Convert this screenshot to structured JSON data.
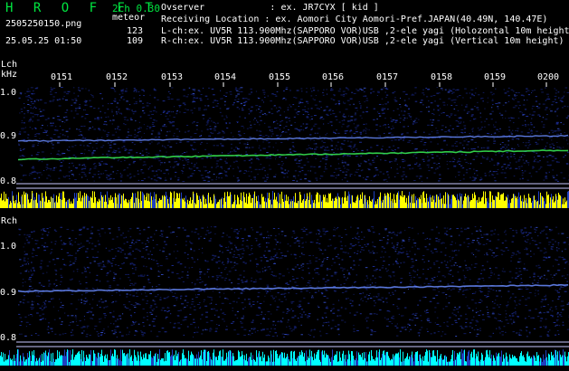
{
  "header": {
    "app_title": "H R O F F T",
    "version": "2ch 0.30",
    "filename": "2505250150.png",
    "mode": "meteor",
    "count_lch": "123",
    "count_rch": "109",
    "datetime": "25.05.25 01:50",
    "observer": "Ovserver            : ex. JR7CYX [ kid ]",
    "location": "Receiving Location : ex. Aomori City Aomori-Pref.JAPAN(40.49N, 140.47E)",
    "lch_info": "L-ch:ex. UV5R 113.900Mhz(SAPPORO VOR)USB ,2-ele yagi (Holozontal 10m height)",
    "rch_info": "R-ch:ex. UV5R 113.900Mhz(SAPPORO VOR)USB ,2-ele yagi (Vertical 10m height)"
  },
  "axis": {
    "lch_label": "Lch",
    "khz_label": "kHz",
    "rch_label": "Rch",
    "time_ticks": [
      "0151",
      "0152",
      "0153",
      "0154",
      "0155",
      "0156",
      "0157",
      "0158",
      "0159",
      "0200"
    ],
    "lch_freq_labels": [
      "1.0",
      "0.9",
      "0.8"
    ],
    "rch_freq_labels": [
      "1.0",
      "0.9",
      "0.8"
    ]
  },
  "colors": {
    "background": "#000000",
    "title_green": "#00e640",
    "noise_blue": "#1a2a8a",
    "signal_blue": "#6a8cff",
    "signal_green": "#3cff5a",
    "bar_yellow": "#ffff00",
    "bar_cyan": "#00ffff",
    "grid_line": "#c8c8ff"
  }
}
